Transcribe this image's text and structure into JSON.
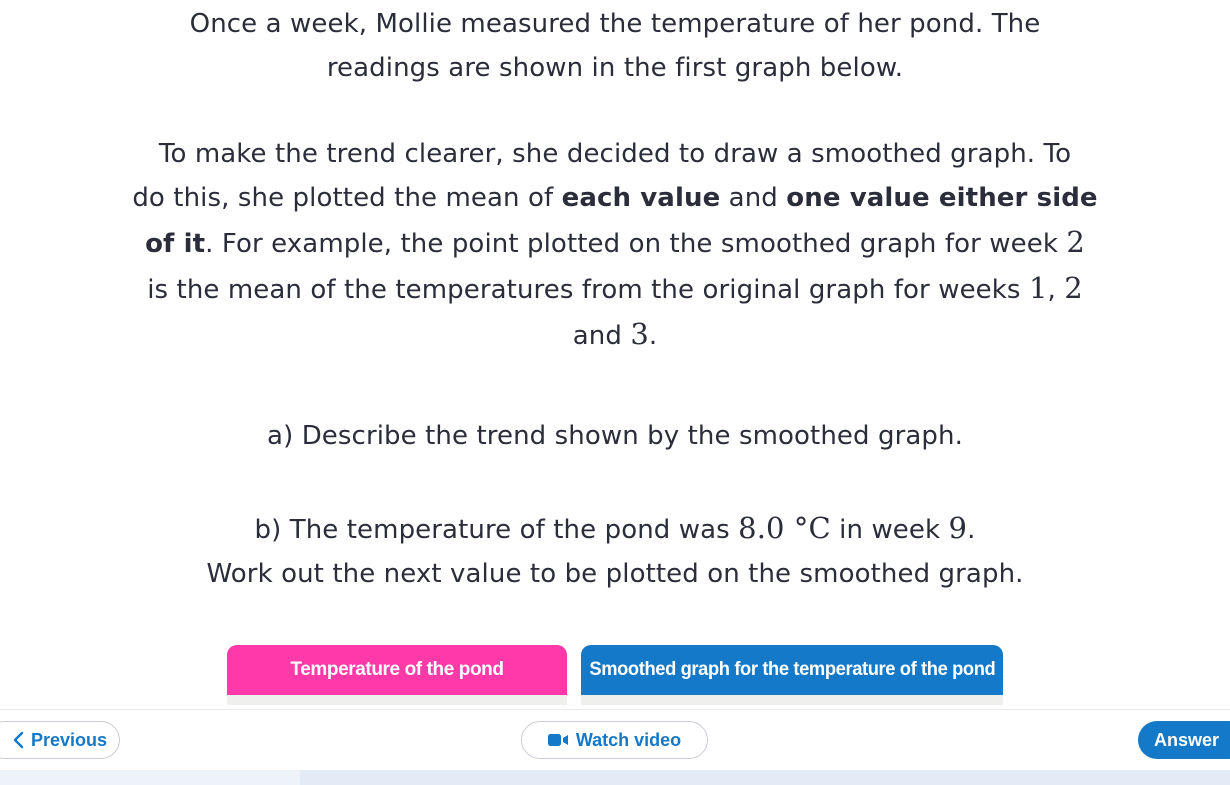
{
  "question": {
    "p1_line1": "Once a week, Mollie measured the temperature of her pond. The",
    "p1_line2": "readings are shown in the first graph below.",
    "p2_line1": "To make the trend clearer, she decided to draw a smoothed graph. To",
    "p2_line2_pre": "do this, she plotted the mean of ",
    "p2_line2_bold1": "each value",
    "p2_line2_mid": " and ",
    "p2_line2_bold2": "one value either side",
    "p2_line3_bold": "of it",
    "p2_line3_rest": ". For example, the point plotted on the smoothed graph for week ",
    "p2_line3_num": "2",
    "p2_line4_pre": "is the mean of the temperatures from the original graph for weeks ",
    "p2_line4_num1": "1",
    "p2_line4_sep": ", ",
    "p2_line4_num2": "2",
    "p2_line5_pre": "and ",
    "p2_line5_num": "3",
    "p2_line5_post": ".",
    "part_a": "a) Describe the trend shown by the smoothed graph.",
    "part_b_pre": "b) The temperature of the pond was ",
    "part_b_value": "8.0",
    "part_b_unit": " °C",
    "part_b_mid": " in week ",
    "part_b_week": "9",
    "part_b_post": ".",
    "part_b_line2": "Work out the next value to be plotted on the smoothed graph."
  },
  "tabs": [
    {
      "label": "Temperature of the pond",
      "color": "#ff3aa8"
    },
    {
      "label": "Smoothed graph for the temperature of the pond",
      "color": "#1479c9"
    }
  ],
  "nav": {
    "previous_label": "Previous",
    "video_label": "Watch video",
    "answer_label": "Answer",
    "previous_icon": "chevron-left-icon",
    "video_icon": "video-camera-icon"
  },
  "colors": {
    "accent_blue": "#1479c9",
    "accent_pink": "#ff3aa8",
    "text": "#2b2d3a"
  }
}
